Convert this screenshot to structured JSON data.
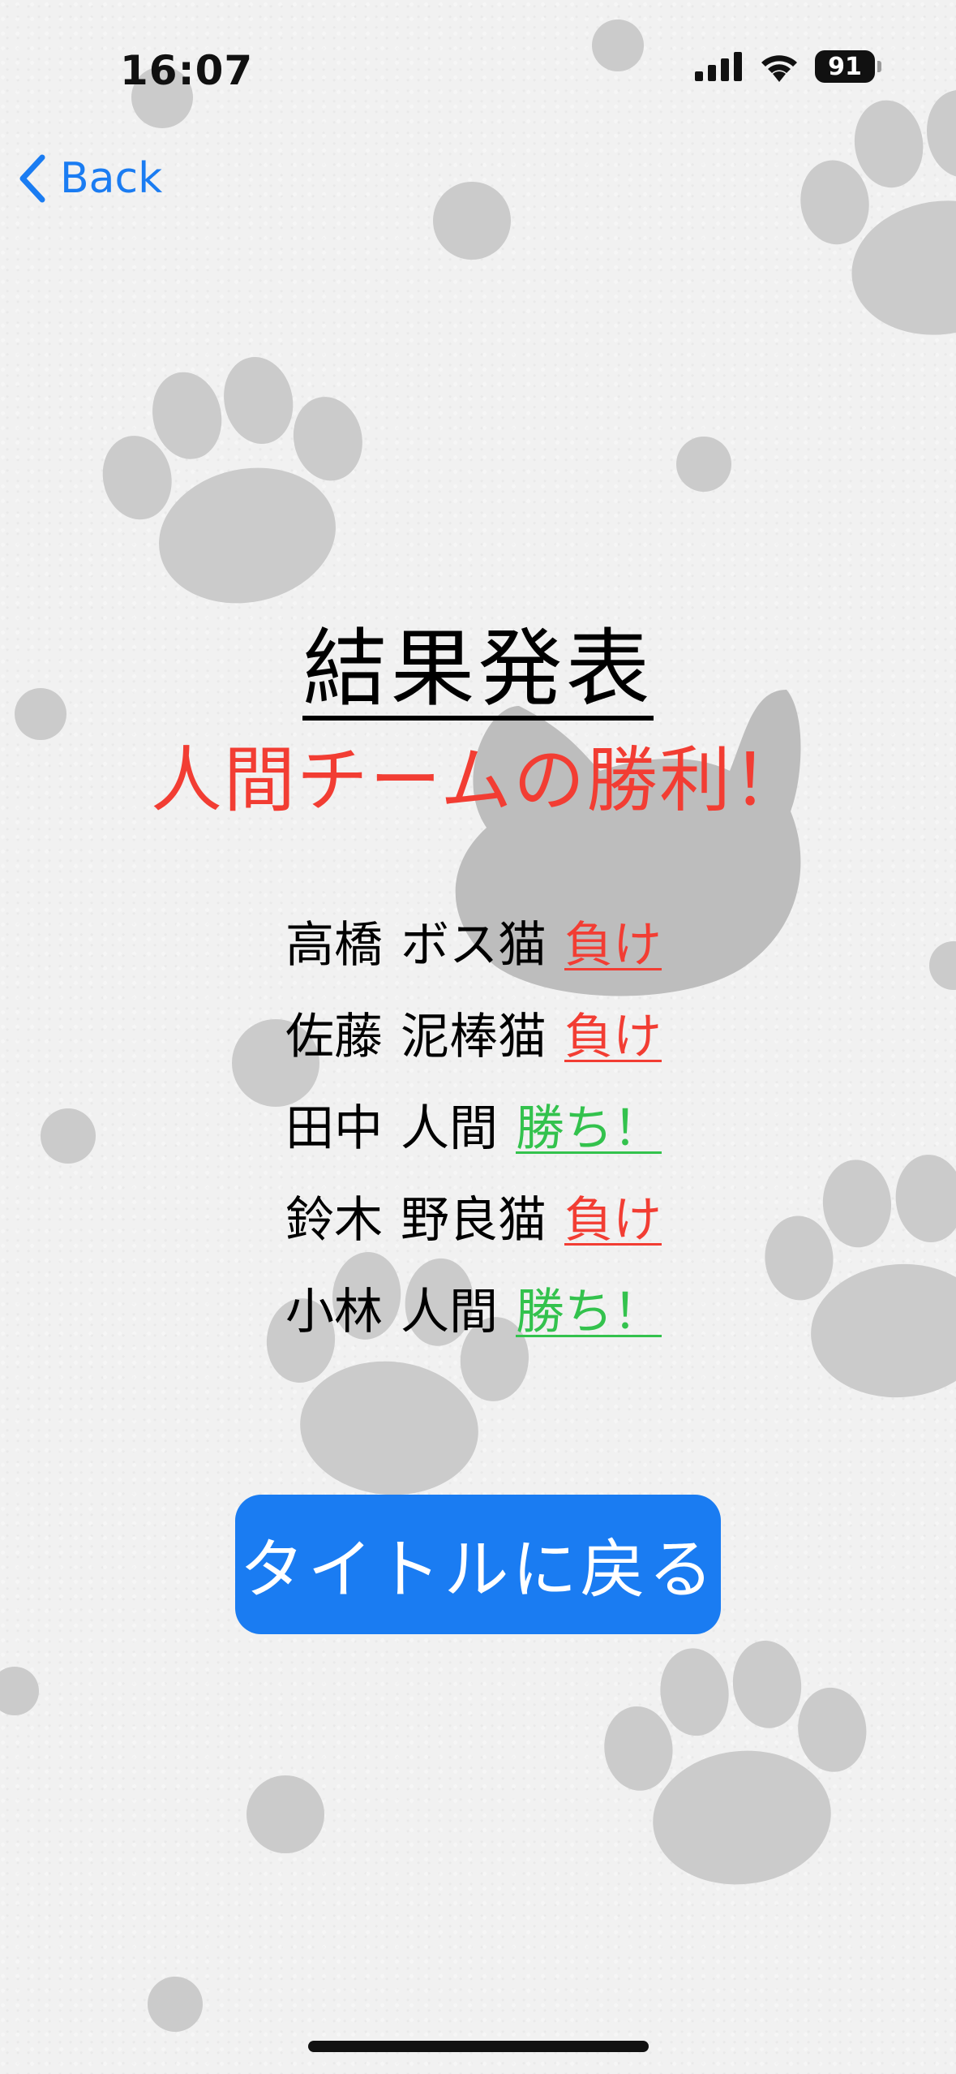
{
  "status_bar": {
    "time": "16:07",
    "battery": "91",
    "signal_icon": "cellular-signal-icon",
    "wifi_icon": "wifi-icon"
  },
  "nav": {
    "back_label": "Back",
    "back_icon": "chevron-left-icon"
  },
  "results": {
    "title": "結果発表",
    "winner_text": "人間チームの勝利！",
    "players": [
      {
        "name": "高橋",
        "role": "ボス猫",
        "outcome": "負け",
        "color": "#f23d33"
      },
      {
        "name": "佐藤",
        "role": "泥棒猫",
        "outcome": "負け",
        "color": "#f23d33"
      },
      {
        "name": "田中",
        "role": "人間",
        "outcome": "勝ち！",
        "color": "#33c24d"
      },
      {
        "name": "鈴木",
        "role": "野良猫",
        "outcome": "負け",
        "color": "#f23d33"
      },
      {
        "name": "小林",
        "role": "人間",
        "outcome": "勝ち！",
        "color": "#33c24d"
      }
    ]
  },
  "button": {
    "label": "タイトルに戻る"
  },
  "colors": {
    "accent": "#1a7cf2",
    "lose": "#f23d33",
    "win": "#33c24d",
    "background": "#f1f1f1"
  }
}
